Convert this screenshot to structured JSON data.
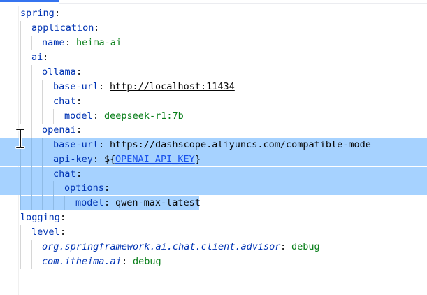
{
  "editor": {
    "lines": [
      {
        "key": "spring",
        "sep": ":"
      },
      {
        "key": "application",
        "sep": ":"
      },
      {
        "key": "name",
        "sep": ": ",
        "value": "heima-ai"
      },
      {
        "key": "ai",
        "sep": ":"
      },
      {
        "key": "ollama",
        "sep": ":"
      },
      {
        "key": "base-url",
        "sep": ": ",
        "value": "http://localhost:11434"
      },
      {
        "key": "chat",
        "sep": ":"
      },
      {
        "key": "model",
        "sep": ": ",
        "value": "deepseek-r1:7b"
      },
      {
        "key": "openai",
        "sep": ":"
      },
      {
        "key": "base-url",
        "sep": ": ",
        "value": "https://dashscope.aliyuncs.com/compatible-mode"
      },
      {
        "key": "api-key",
        "sep": ": ",
        "value_prefix": "${",
        "value": "OPENAI_API_KEY",
        "value_suffix": "}"
      },
      {
        "key": "chat",
        "sep": ":"
      },
      {
        "key": "options",
        "sep": ":"
      },
      {
        "key": "model",
        "sep": ": ",
        "value": "qwen-max-latest"
      },
      {
        "key": "logging",
        "sep": ":"
      },
      {
        "key": "level",
        "sep": ":"
      },
      {
        "key": "org.springframework.ai.chat.client.advisor",
        "sep": ": ",
        "value": "debug"
      },
      {
        "key": "com.itheima.ai",
        "sep": ": ",
        "value": "debug"
      }
    ]
  },
  "colors": {
    "key": "#0033b3",
    "value": "#067d17",
    "selection": "#a6d2ff",
    "accent": "#3574f0"
  },
  "icons": {
    "cursor": "text-cursor-icon"
  }
}
